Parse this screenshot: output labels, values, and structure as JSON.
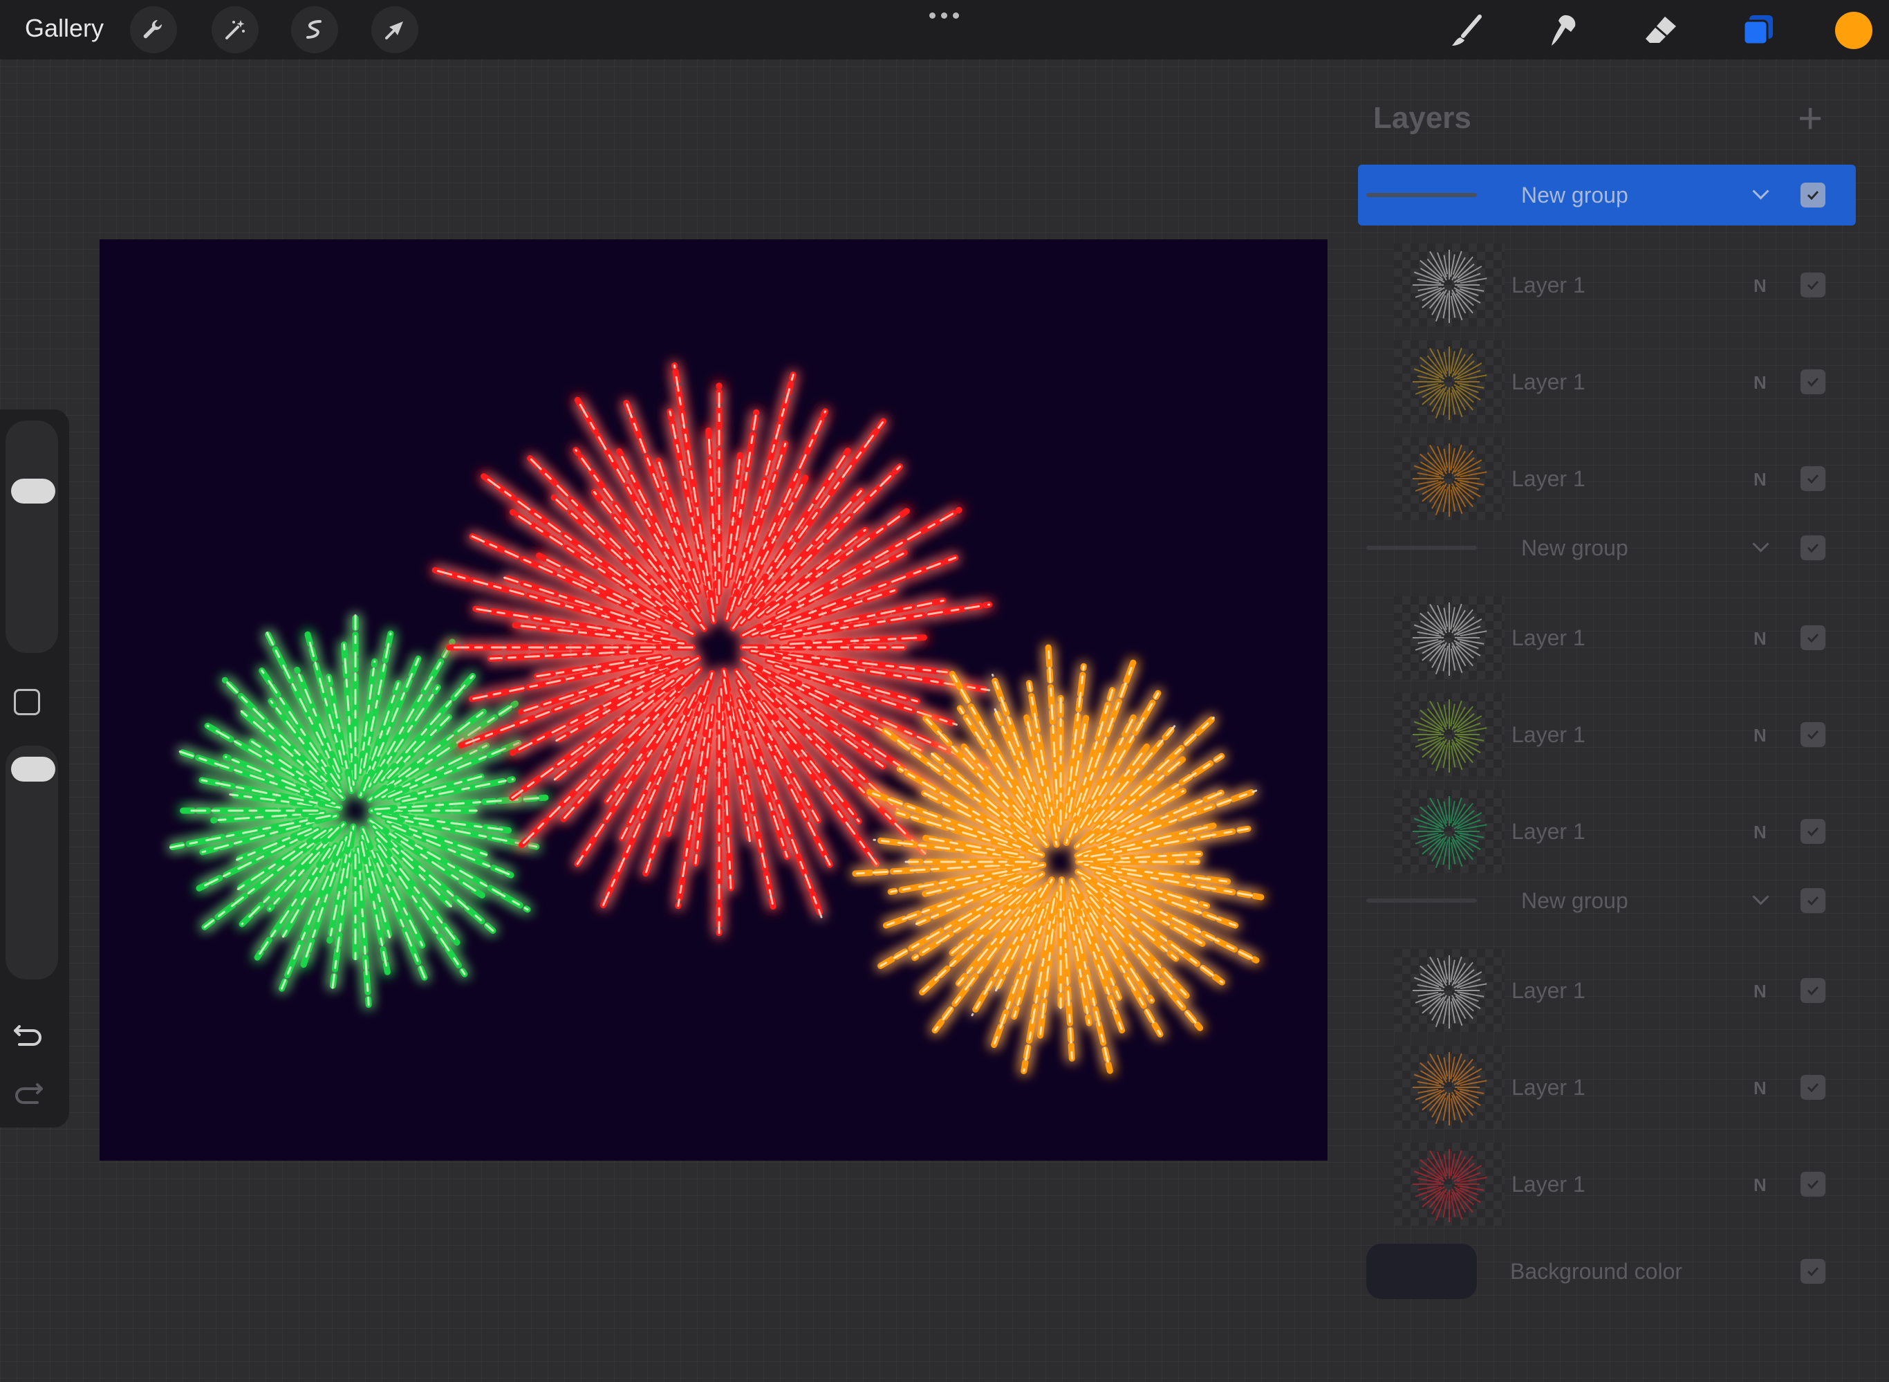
{
  "topbar": {
    "gallery_label": "Gallery",
    "tools_left": [
      "wrench-icon",
      "magic-wand-icon",
      "selection-icon",
      "transform-arrow-icon"
    ],
    "tools_right": [
      "brush-icon",
      "smudge-icon",
      "eraser-icon",
      "layers-icon"
    ],
    "active_color": "#ff9f0a",
    "layers_accent": "#1e6ff5"
  },
  "sidebar": {
    "icons": [
      "size-slider",
      "modify-square-icon",
      "opacity-slider",
      "undo-icon",
      "redo-icon"
    ]
  },
  "canvas": {
    "background_color": "#0e0222",
    "fireworks": [
      {
        "color": "green",
        "hex": "#1fd44a"
      },
      {
        "color": "red",
        "hex": "#ff1a1a"
      },
      {
        "color": "orange",
        "hex": "#ff9a0a"
      }
    ]
  },
  "layers": {
    "title": "Layers",
    "add_symbol": "+",
    "rows": [
      {
        "type": "group",
        "name": "New group",
        "selected": true
      },
      {
        "type": "layer",
        "name": "Layer 1",
        "mode": "N",
        "thumb": "#e8e8e8"
      },
      {
        "type": "layer",
        "name": "Layer 1",
        "mode": "N",
        "thumb": "#d4a017"
      },
      {
        "type": "layer",
        "name": "Layer 1",
        "mode": "N",
        "thumb": "#ff8a00"
      },
      {
        "type": "group",
        "name": "New group"
      },
      {
        "type": "layer",
        "name": "Layer 1",
        "mode": "N",
        "thumb": "#e8e8e8"
      },
      {
        "type": "layer",
        "name": "Layer 1",
        "mode": "N",
        "thumb": "#8bc12a"
      },
      {
        "type": "layer",
        "name": "Layer 1",
        "mode": "N",
        "thumb": "#19c46a"
      },
      {
        "type": "group",
        "name": "New group"
      },
      {
        "type": "layer",
        "name": "Layer 1",
        "mode": "N",
        "thumb": "#e8e8e8"
      },
      {
        "type": "layer",
        "name": "Layer 1",
        "mode": "N",
        "thumb": "#ff8a1a"
      },
      {
        "type": "layer",
        "name": "Layer 1",
        "mode": "N",
        "thumb": "#ee1e2e"
      }
    ],
    "background_label": "Background color"
  }
}
